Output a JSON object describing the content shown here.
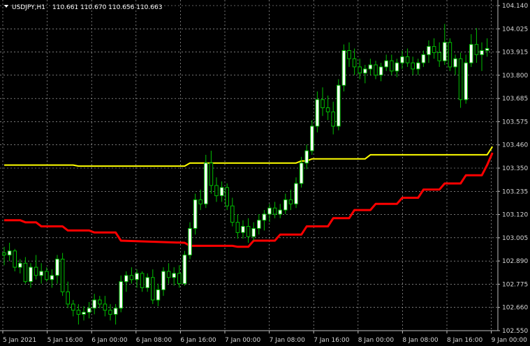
{
  "header": {
    "symbol_label": "USDJPY,H1",
    "ohlc_label": "110.661 110.670 110.656 110.663"
  },
  "chart_data": {
    "type": "candlestick",
    "title": "USDJPY,H1",
    "ylim": [
      102.55,
      104.14
    ],
    "y_ticks": [
      "104.140",
      "104.025",
      "103.915",
      "103.800",
      "103.685",
      "103.575",
      "103.460",
      "103.350",
      "103.235",
      "103.120",
      "103.005",
      "102.890",
      "102.775",
      "102.660",
      "102.550"
    ],
    "x_ticks": [
      "5 Jan 2021",
      "5 Jan 16:00",
      "6 Jan 00:00",
      "6 Jan 08:00",
      "6 Jan 16:00",
      "7 Jan 00:00",
      "7 Jan 08:00",
      "7 Jan 16:00",
      "8 Jan 00:00",
      "8 Jan 08:00",
      "8 Jan 16:00",
      "9 Jan 00:00"
    ],
    "grid": true,
    "colors": {
      "background": "#000000",
      "grid": "#c0c0c0",
      "bull": "#ffffff",
      "bear": "#000000",
      "outline": "#00c000",
      "upper_line": "#ffff00",
      "lower_line": "#ff0000"
    },
    "candles": [
      [
        102.93,
        102.96,
        102.87,
        102.92
      ],
      [
        102.92,
        102.98,
        102.89,
        102.94
      ],
      [
        102.94,
        102.95,
        102.84,
        102.86
      ],
      [
        102.86,
        102.9,
        102.83,
        102.88
      ],
      [
        102.88,
        102.91,
        102.78,
        102.79
      ],
      [
        102.79,
        102.88,
        102.76,
        102.86
      ],
      [
        102.86,
        102.92,
        102.8,
        102.82
      ],
      [
        102.82,
        102.88,
        102.78,
        102.84
      ],
      [
        102.84,
        102.86,
        102.79,
        102.8
      ],
      [
        102.8,
        102.85,
        102.76,
        102.82
      ],
      [
        102.82,
        102.92,
        102.78,
        102.9
      ],
      [
        102.9,
        102.93,
        102.72,
        102.74
      ],
      [
        102.74,
        102.79,
        102.66,
        102.68
      ],
      [
        102.68,
        102.7,
        102.62,
        102.65
      ],
      [
        102.65,
        102.68,
        102.58,
        102.63
      ],
      [
        102.63,
        102.67,
        102.6,
        102.64
      ],
      [
        102.64,
        102.69,
        102.61,
        102.66
      ],
      [
        102.66,
        102.73,
        102.63,
        102.7
      ],
      [
        102.7,
        102.72,
        102.66,
        102.68
      ],
      [
        102.68,
        102.72,
        102.62,
        102.65
      ],
      [
        102.65,
        102.68,
        102.6,
        102.63
      ],
      [
        102.63,
        102.68,
        102.58,
        102.66
      ],
      [
        102.66,
        102.82,
        102.64,
        102.79
      ],
      [
        102.79,
        102.84,
        102.74,
        102.82
      ],
      [
        102.82,
        102.86,
        102.78,
        102.8
      ],
      [
        102.8,
        102.85,
        102.76,
        102.83
      ],
      [
        102.83,
        102.84,
        102.74,
        102.76
      ],
      [
        102.76,
        102.83,
        102.74,
        102.81
      ],
      [
        102.81,
        102.85,
        102.68,
        102.7
      ],
      [
        102.7,
        102.78,
        102.67,
        102.75
      ],
      [
        102.75,
        102.86,
        102.72,
        102.84
      ],
      [
        102.84,
        102.88,
        102.78,
        102.81
      ],
      [
        102.81,
        102.86,
        102.77,
        102.83
      ],
      [
        102.83,
        102.87,
        102.76,
        102.78
      ],
      [
        102.78,
        102.94,
        102.77,
        102.92
      ],
      [
        102.92,
        103.08,
        102.9,
        103.05
      ],
      [
        103.05,
        103.22,
        103.02,
        103.19
      ],
      [
        103.19,
        103.24,
        103.14,
        103.17
      ],
      [
        103.17,
        103.41,
        103.15,
        103.37
      ],
      [
        103.37,
        103.43,
        103.22,
        103.26
      ],
      [
        103.26,
        103.3,
        103.18,
        103.21
      ],
      [
        103.21,
        103.28,
        103.18,
        103.25
      ],
      [
        103.25,
        103.27,
        103.14,
        103.16
      ],
      [
        103.16,
        103.2,
        103.06,
        103.08
      ],
      [
        103.08,
        103.12,
        103.0,
        103.03
      ],
      [
        103.03,
        103.09,
        103.0,
        103.06
      ],
      [
        103.06,
        103.1,
        102.98,
        103.01
      ],
      [
        103.01,
        103.08,
        102.99,
        103.05
      ],
      [
        103.05,
        103.12,
        103.02,
        103.09
      ],
      [
        103.09,
        103.14,
        103.04,
        103.12
      ],
      [
        103.12,
        103.17,
        103.08,
        103.15
      ],
      [
        103.15,
        103.18,
        103.1,
        103.12
      ],
      [
        103.12,
        103.17,
        103.1,
        103.14
      ],
      [
        103.14,
        103.22,
        103.12,
        103.19
      ],
      [
        103.19,
        103.24,
        103.14,
        103.17
      ],
      [
        103.17,
        103.3,
        103.15,
        103.27
      ],
      [
        103.27,
        103.4,
        103.25,
        103.37
      ],
      [
        103.37,
        103.46,
        103.34,
        103.43
      ],
      [
        103.43,
        103.58,
        103.41,
        103.55
      ],
      [
        103.55,
        103.72,
        103.52,
        103.68
      ],
      [
        103.68,
        103.74,
        103.6,
        103.64
      ],
      [
        103.64,
        103.7,
        103.58,
        103.62
      ],
      [
        103.62,
        103.67,
        103.51,
        103.55
      ],
      [
        103.55,
        103.78,
        103.53,
        103.75
      ],
      [
        103.75,
        103.95,
        103.72,
        103.92
      ],
      [
        103.92,
        103.96,
        103.84,
        103.88
      ],
      [
        103.88,
        103.93,
        103.8,
        103.84
      ],
      [
        103.84,
        103.88,
        103.78,
        103.81
      ],
      [
        103.81,
        103.85,
        103.76,
        103.83
      ],
      [
        103.83,
        103.88,
        103.8,
        103.85
      ],
      [
        103.85,
        103.87,
        103.78,
        103.8
      ],
      [
        103.8,
        103.86,
        103.77,
        103.84
      ],
      [
        103.84,
        103.9,
        103.82,
        103.87
      ],
      [
        103.87,
        103.9,
        103.8,
        103.82
      ],
      [
        103.82,
        103.88,
        103.79,
        103.86
      ],
      [
        103.86,
        103.92,
        103.83,
        103.89
      ],
      [
        103.89,
        103.93,
        103.84,
        103.86
      ],
      [
        103.86,
        103.89,
        103.8,
        103.83
      ],
      [
        103.83,
        103.88,
        103.8,
        103.86
      ],
      [
        103.86,
        103.92,
        103.84,
        103.9
      ],
      [
        103.9,
        103.97,
        103.86,
        103.94
      ],
      [
        103.94,
        103.98,
        103.88,
        103.91
      ],
      [
        103.91,
        103.96,
        103.84,
        103.87
      ],
      [
        103.87,
        104.05,
        103.85,
        103.96
      ],
      [
        103.96,
        103.98,
        103.82,
        103.84
      ],
      [
        103.84,
        103.9,
        103.8,
        103.88
      ],
      [
        103.88,
        103.91,
        103.64,
        103.68
      ],
      [
        103.68,
        103.9,
        103.66,
        103.86
      ],
      [
        103.86,
        104.0,
        103.84,
        103.95
      ],
      [
        103.95,
        104.03,
        103.86,
        103.9
      ],
      [
        103.9,
        103.96,
        103.82,
        103.92
      ],
      [
        103.92,
        103.98,
        103.89,
        103.93
      ]
    ],
    "series": [
      {
        "points": [
          [
            0,
            103.36
          ],
          [
            13,
            103.36
          ],
          [
            14,
            103.355
          ],
          [
            34,
            103.355
          ],
          [
            35,
            103.37
          ],
          [
            55,
            103.37
          ],
          [
            56,
            103.38
          ],
          [
            57,
            103.38
          ],
          [
            58,
            103.39
          ],
          [
            68,
            103.39
          ],
          [
            69,
            103.41
          ],
          [
            91,
            103.41
          ],
          [
            92,
            103.45
          ]
        ]
      },
      {
        "points": [
          [
            0,
            103.09
          ],
          [
            3,
            103.09
          ],
          [
            4,
            103.08
          ],
          [
            6,
            103.08
          ],
          [
            7,
            103.06
          ],
          [
            11,
            103.06
          ],
          [
            12,
            103.04
          ],
          [
            16,
            103.04
          ],
          [
            17,
            103.03
          ],
          [
            21,
            103.03
          ],
          [
            22,
            102.99
          ],
          [
            34,
            102.98
          ],
          [
            35,
            102.965
          ],
          [
            43,
            102.965
          ],
          [
            44,
            102.96
          ],
          [
            46,
            102.96
          ],
          [
            47,
            102.99
          ],
          [
            51,
            102.99
          ],
          [
            52,
            103.02
          ],
          [
            56,
            103.02
          ],
          [
            57,
            103.06
          ],
          [
            61,
            103.06
          ],
          [
            62,
            103.1
          ],
          [
            65,
            103.1
          ],
          [
            66,
            103.14
          ],
          [
            69,
            103.14
          ],
          [
            70,
            103.17
          ],
          [
            74,
            103.17
          ],
          [
            75,
            103.2
          ],
          [
            78,
            103.2
          ],
          [
            79,
            103.24
          ],
          [
            82,
            103.24
          ],
          [
            83,
            103.27
          ],
          [
            86,
            103.27
          ],
          [
            87,
            103.31
          ],
          [
            90,
            103.31
          ],
          [
            91,
            103.36
          ],
          [
            92,
            103.42
          ]
        ]
      }
    ]
  }
}
